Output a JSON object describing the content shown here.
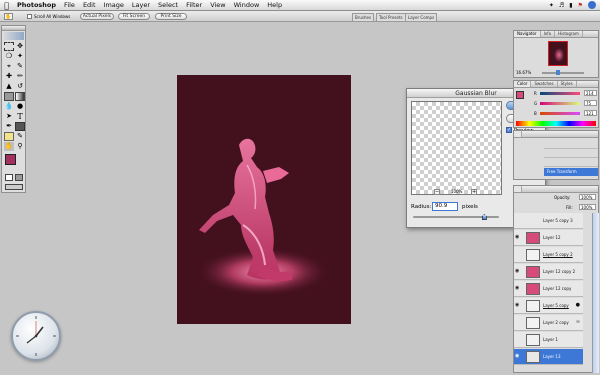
{
  "menubar": {
    "apple_icon": "apple-logo",
    "items": [
      "Photoshop",
      "File",
      "Edit",
      "Image",
      "Layer",
      "Select",
      "Filter",
      "View",
      "Window",
      "Help"
    ],
    "right_icons": [
      "bluetooth-icon",
      "volume-icon",
      "battery-icon",
      "flag-icon",
      "spotlight-icon"
    ]
  },
  "options_bar": {
    "scroll_all_windows": "Scroll All Windows",
    "buttons": [
      "Actual Pixels",
      "Fit Screen",
      "Print Size"
    ],
    "palette_well_tabs": [
      "Brushes",
      "Tool Presets",
      "Layer Comps"
    ]
  },
  "navigator": {
    "tabs": [
      "Navigator",
      "Info",
      "Histogram"
    ],
    "zoom": "16.67%"
  },
  "color_panel": {
    "tabs": [
      "Color",
      "Swatches",
      "Styles"
    ],
    "channels": [
      {
        "label": "R",
        "value": "214"
      },
      {
        "label": "G",
        "value": "75"
      },
      {
        "label": "B",
        "value": "121"
      }
    ]
  },
  "history": {
    "items": [
      "Free Transform"
    ]
  },
  "dialog": {
    "title": "Gaussian Blur",
    "ok": "OK",
    "cancel": "Cancel",
    "preview_label": "Preview",
    "preview_checked": true,
    "zoom_percent": "100%",
    "radius_label": "Radius:",
    "radius_value": "90.9",
    "radius_unit": "pixels",
    "radius_slider_fraction": 0.83
  },
  "layers": {
    "opacity_label": "Opacity:",
    "opacity_value": "100%",
    "fill_label": "Fill:",
    "fill_value": "100%",
    "rows": [
      {
        "name": "Layer 5 copy 3"
      },
      {
        "name": "Layer 12"
      },
      {
        "name": "Layer 5 copy 2"
      },
      {
        "name": "Layer 12 copy 2"
      },
      {
        "name": "Layer 12 copy"
      },
      {
        "name": "Layer 5 copy"
      },
      {
        "name": "Layer 2 copy"
      },
      {
        "name": "Layer 1"
      },
      {
        "name": "Layer 13"
      }
    ]
  },
  "colors": {
    "canvas_bg": "#43101e",
    "accent_pink": "#d64b79",
    "selection_blue": "#3d78d6"
  }
}
